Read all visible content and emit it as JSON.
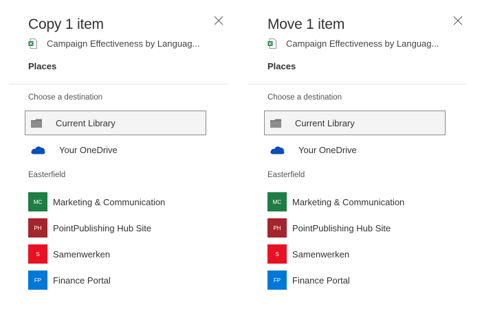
{
  "panels": [
    {
      "title": "Copy 1 item",
      "file_name": "Campaign Effectiveness by Languag...",
      "places_label": "Places",
      "choose_label": "Choose a destination",
      "current_library": "Current Library",
      "onedrive": "Your OneDrive",
      "group_label": "Easterfield",
      "sites": [
        {
          "initials": "MC",
          "name": "Marketing & Communication",
          "color": "#1e7e45"
        },
        {
          "initials": "PH",
          "name": "PointPublishing Hub Site",
          "color": "#a4262c"
        },
        {
          "initials": "S",
          "name": "Samenwerken",
          "color": "#e81123"
        },
        {
          "initials": "FP",
          "name": "Finance Portal",
          "color": "#0078d7"
        }
      ]
    },
    {
      "title": "Move 1 item",
      "file_name": "Campaign Effectiveness by Languag...",
      "places_label": "Places",
      "choose_label": "Choose a destination",
      "current_library": "Current Library",
      "onedrive": "Your OneDrive",
      "group_label": "Easterfield",
      "sites": [
        {
          "initials": "MC",
          "name": "Marketing & Communication",
          "color": "#1e7e45"
        },
        {
          "initials": "PH",
          "name": "PointPublishing Hub Site",
          "color": "#a4262c"
        },
        {
          "initials": "S",
          "name": "Samenwerken",
          "color": "#e81123"
        },
        {
          "initials": "FP",
          "name": "Finance Portal",
          "color": "#0078d7"
        }
      ]
    }
  ],
  "icons": {
    "file": "excel-file-icon",
    "close": "close-icon",
    "folder": "folder-icon",
    "onedrive": "onedrive-cloud-icon"
  },
  "colors": {
    "excel_green": "#1e7e45",
    "onedrive_blue": "#0a4fb8",
    "folder_gray": "#7a7a7a",
    "selected_bg": "#f4f4f4",
    "selected_border": "#8a8a8a"
  }
}
